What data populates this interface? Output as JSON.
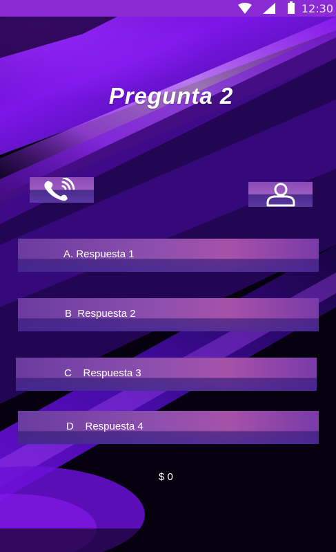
{
  "status_bar": {
    "time": "12:30",
    "icons": [
      "wifi-icon",
      "signal-icon",
      "battery-icon"
    ]
  },
  "question": {
    "title": "Pregunta 2"
  },
  "lifelines": {
    "call_icon": "phone-call-icon",
    "audience_icon": "person-icon"
  },
  "answers": [
    {
      "label": "A. Respuesta 1"
    },
    {
      "label": "B  Respuesta 2"
    },
    {
      "label": "C    Respuesta 3"
    },
    {
      "label": "D    Respuesta 4"
    }
  ],
  "prize": "$ 0",
  "colors": {
    "status_bar": "#8a2bd6",
    "accent_purple": "#9b1bff",
    "background": "#06010f",
    "button_pink": "#a552a8",
    "button_blue": "#4b2d8f"
  }
}
